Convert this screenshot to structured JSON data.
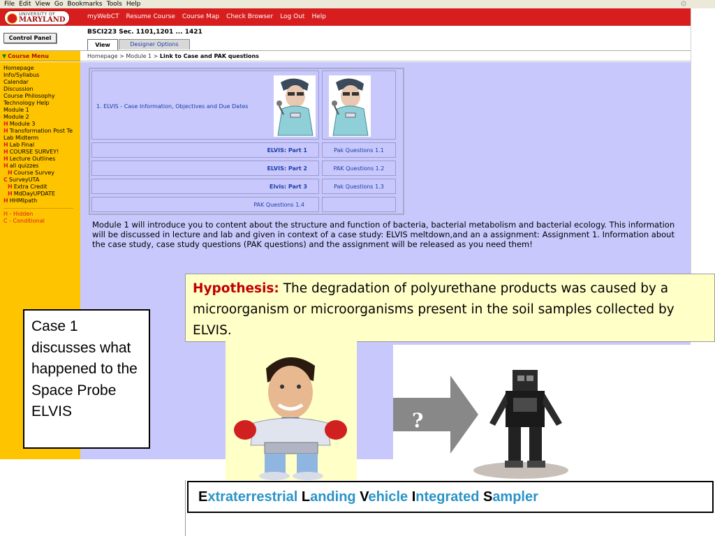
{
  "browser_menu": [
    "File",
    "Edit",
    "View",
    "Go",
    "Bookmarks",
    "Tools",
    "Help"
  ],
  "logo": {
    "line1": "UNIVERSITY OF",
    "line2": "MARYLAND"
  },
  "top_nav": [
    "myWebCT",
    "Resume Course",
    "Course Map",
    "Check Browser",
    "Log Out",
    "Help"
  ],
  "control_panel_label": "Control Panel",
  "course_title": "BSCI223 Sec. 1101,1201 ... 1421",
  "tabs": {
    "view": "View",
    "designer": "Designer Options"
  },
  "course_menu_title": "Course Menu",
  "breadcrumb": {
    "trail": "Homepage > Module 1 > ",
    "current": "Link to Case and PAK questions"
  },
  "course_menu": [
    {
      "mark": "",
      "label": "Homepage",
      "indent": false
    },
    {
      "mark": "",
      "label": "Info/Syllabus",
      "indent": false
    },
    {
      "mark": "",
      "label": "Calendar",
      "indent": false
    },
    {
      "mark": "",
      "label": "Discussion",
      "indent": false
    },
    {
      "mark": "",
      "label": "Course Philosophy",
      "indent": false
    },
    {
      "mark": "",
      "label": "Technology Help",
      "indent": false
    },
    {
      "mark": "",
      "label": "Module 1",
      "indent": false
    },
    {
      "mark": "",
      "label": "Module 2",
      "indent": false
    },
    {
      "mark": "H",
      "label": "Module 3",
      "indent": false
    },
    {
      "mark": "H",
      "label": "Transformation Post Te",
      "indent": false
    },
    {
      "mark": "",
      "label": "Lab Midterm",
      "indent": false
    },
    {
      "mark": "H",
      "label": "Lab Final",
      "indent": false
    },
    {
      "mark": "H",
      "label": "COURSE SURVEY!",
      "indent": false
    },
    {
      "mark": "H",
      "label": "Lecture Outlines",
      "indent": false
    },
    {
      "mark": "H",
      "label": "all quizzes",
      "indent": false
    },
    {
      "mark": "H",
      "label": "Course Survey",
      "indent": true
    },
    {
      "mark": "C",
      "label": "SurveyUTA",
      "indent": false
    },
    {
      "mark": "H",
      "label": "Extra Credit",
      "indent": true
    },
    {
      "mark": "H",
      "label": "MdDayUPDATE",
      "indent": true
    },
    {
      "mark": "H",
      "label": "HHMIpath",
      "indent": false
    }
  ],
  "legend": [
    "H - Hidden",
    "C - Conditional"
  ],
  "case_table": {
    "header_text": "1. ELVIS - Case Information, Objectives and Due Dates",
    "rows": [
      {
        "part": "ELVIS: Part 1",
        "pak": "Pak Questions 1.1"
      },
      {
        "part": "ELVIS: Part 2",
        "pak": "PAK Questions 1.2"
      },
      {
        "part": "Elvis: Part 3",
        "pak": "Pak Questions 1.3"
      },
      {
        "part": "PAK Questions 1.4",
        "pak": ""
      }
    ]
  },
  "intro_text": "Module 1 will introduce you to content about the structure and function of bacteria, bacterial metabolism and bacterial ecology. This information will be discussed in lecture and lab and given in context of a case study: ELVIS meltdown,and an a assignment: Assignment 1. Information about the case study, case study questions (PAK questions) and the assignment will be released as you need them!",
  "hypothesis": {
    "label": "Hypothesis:",
    "text": " The degradation of polyurethane products was caused by a microorganism or microorganisms present in the soil samples collected by ELVIS."
  },
  "case_note": "Case 1 discusses what happened to the Space Probe ELVIS",
  "arrow_label": "?",
  "acronym": [
    {
      "initial": "E",
      "rest": "xtraterrestrial "
    },
    {
      "initial": "L",
      "rest": "anding "
    },
    {
      "initial": "V",
      "rest": "ehicle "
    },
    {
      "initial": "I",
      "rest": "ntegrated "
    },
    {
      "initial": "S",
      "rest": "ampler"
    }
  ],
  "colors": {
    "header_red": "#d71d1d",
    "menu_yellow": "#ffc400",
    "content_lavender": "#c8c8fc",
    "hypothesis_bg": "#ffffc8",
    "acronym_blue": "#2a93c8"
  }
}
